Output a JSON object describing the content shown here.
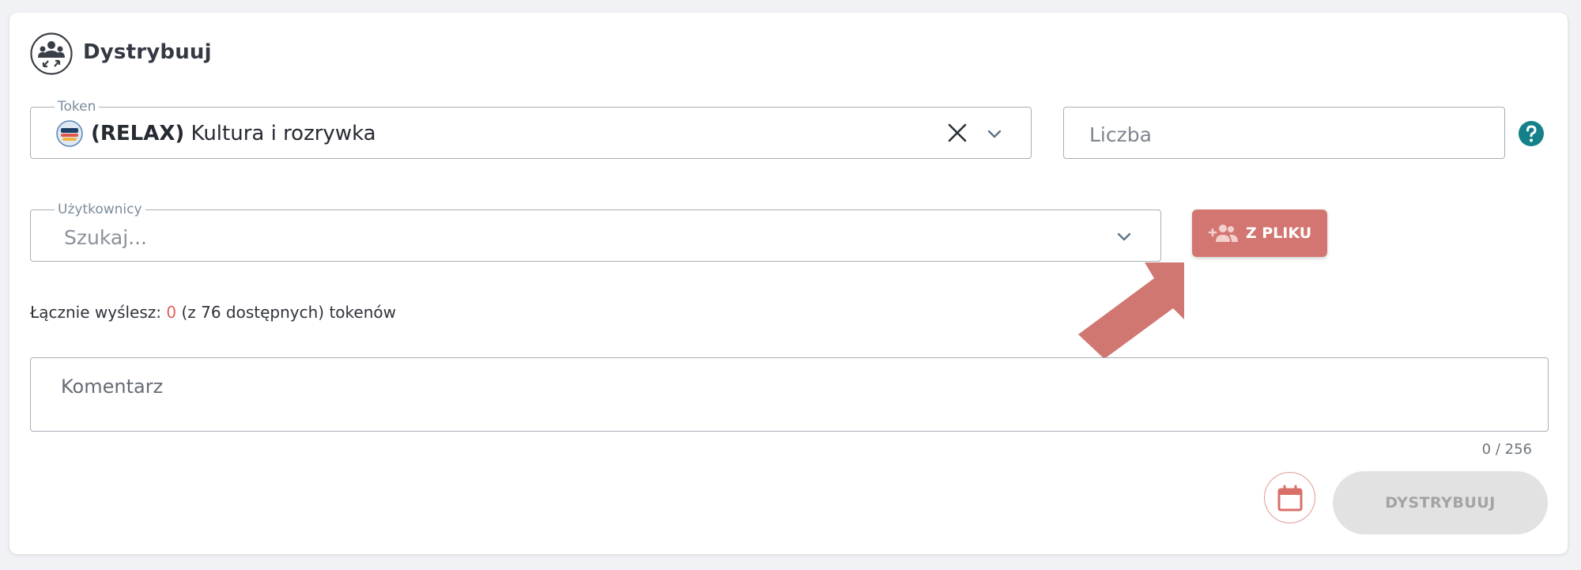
{
  "header": {
    "title": "Dystrybuuj",
    "icon": "distribute-people-icon"
  },
  "token_field": {
    "legend": "Token",
    "value_symbol": "(RELAX)",
    "value_name": " Kultura i rozrywka",
    "icon": "token-logo-icon"
  },
  "amount_field": {
    "placeholder": "Liczba"
  },
  "users_field": {
    "legend": "Użytkownicy",
    "placeholder": "Szukaj..."
  },
  "from_file_button": {
    "label": "Z PLIKU",
    "icon": "add-users-icon"
  },
  "summary": {
    "prefix": "Łącznie wyślesz: ",
    "count": "0",
    "suffix": " (z 76 dostępnych) tokenów"
  },
  "comment": {
    "placeholder": "Komentarz",
    "counter": "0 / 256"
  },
  "actions": {
    "calendar_icon": "calendar-icon",
    "submit_label": "DYSTRYBUUJ"
  },
  "colors": {
    "accent": "#d37671",
    "help": "#13808a",
    "highlight_zero": "#e0605a",
    "disabled": "#e2e2e2"
  }
}
